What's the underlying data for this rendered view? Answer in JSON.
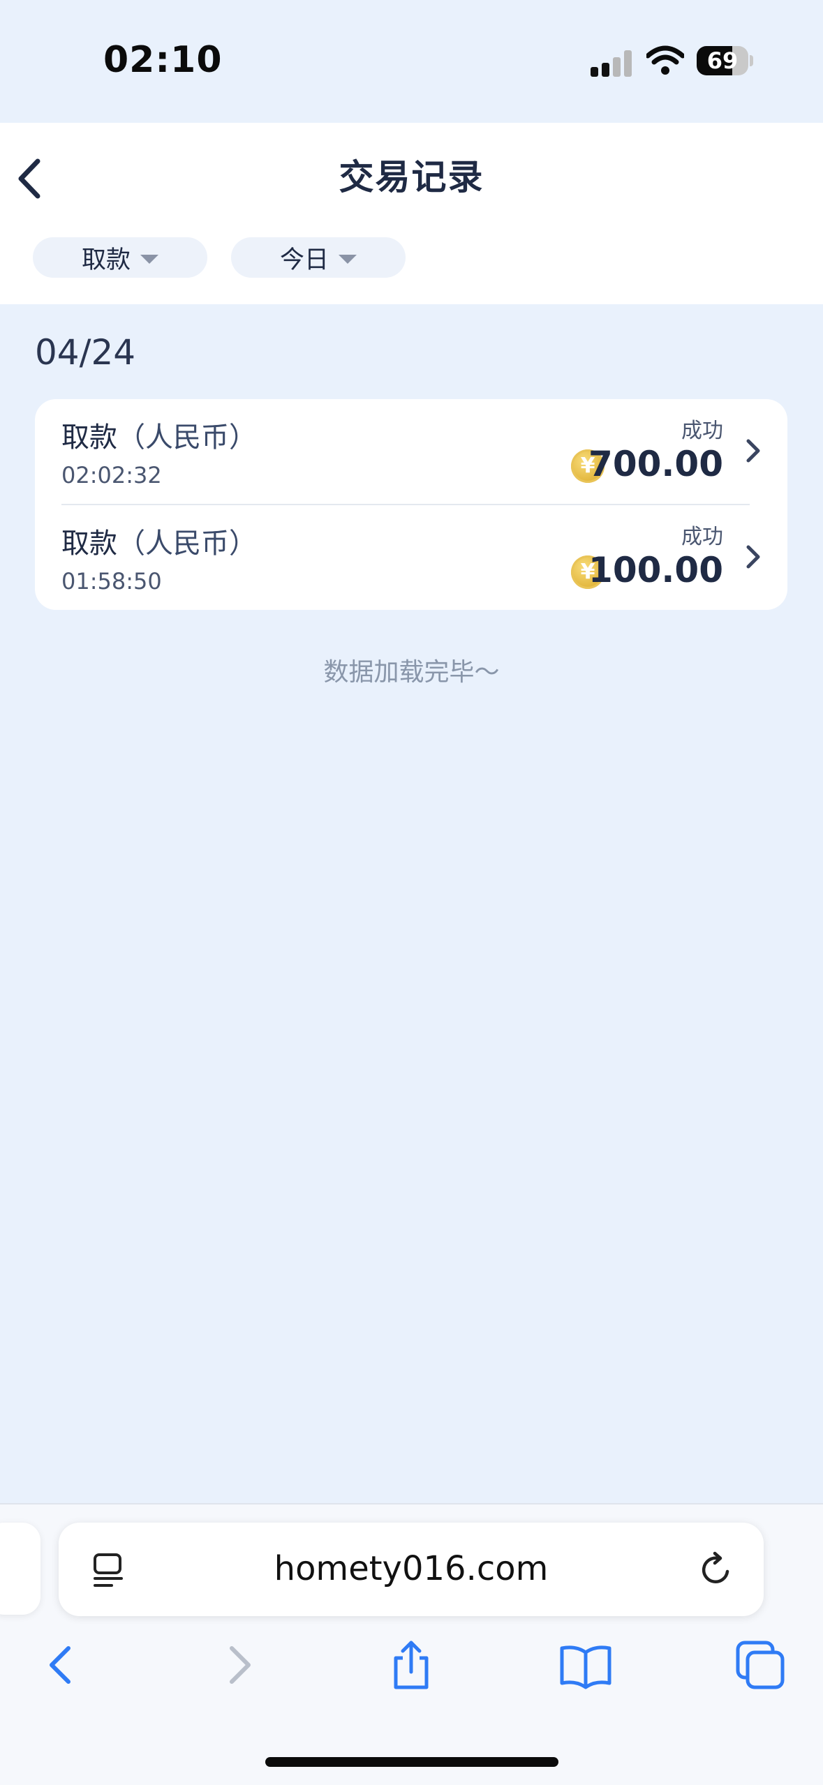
{
  "status_bar": {
    "time": "02:10",
    "battery_level": "69",
    "battery_fraction": 0.69
  },
  "header": {
    "title": "交易记录"
  },
  "filters": [
    {
      "label": "取款"
    },
    {
      "label": "今日"
    }
  ],
  "date_group": "04/24",
  "transactions": [
    {
      "type": "取款",
      "currency": "（人民币）",
      "time": "02:02:32",
      "status": "成功",
      "amount": "700.00"
    },
    {
      "type": "取款",
      "currency": "（人民币）",
      "time": "01:58:50",
      "status": "成功",
      "amount": "100.00"
    }
  ],
  "coin_symbol": "¥",
  "end_note": "数据加载完毕～",
  "browser": {
    "url": "homety016.com"
  },
  "colors": {
    "accent_blue": "#2f7bf5",
    "page_bg": "#e9f1fc",
    "coin_gold": "#e2b63c"
  }
}
